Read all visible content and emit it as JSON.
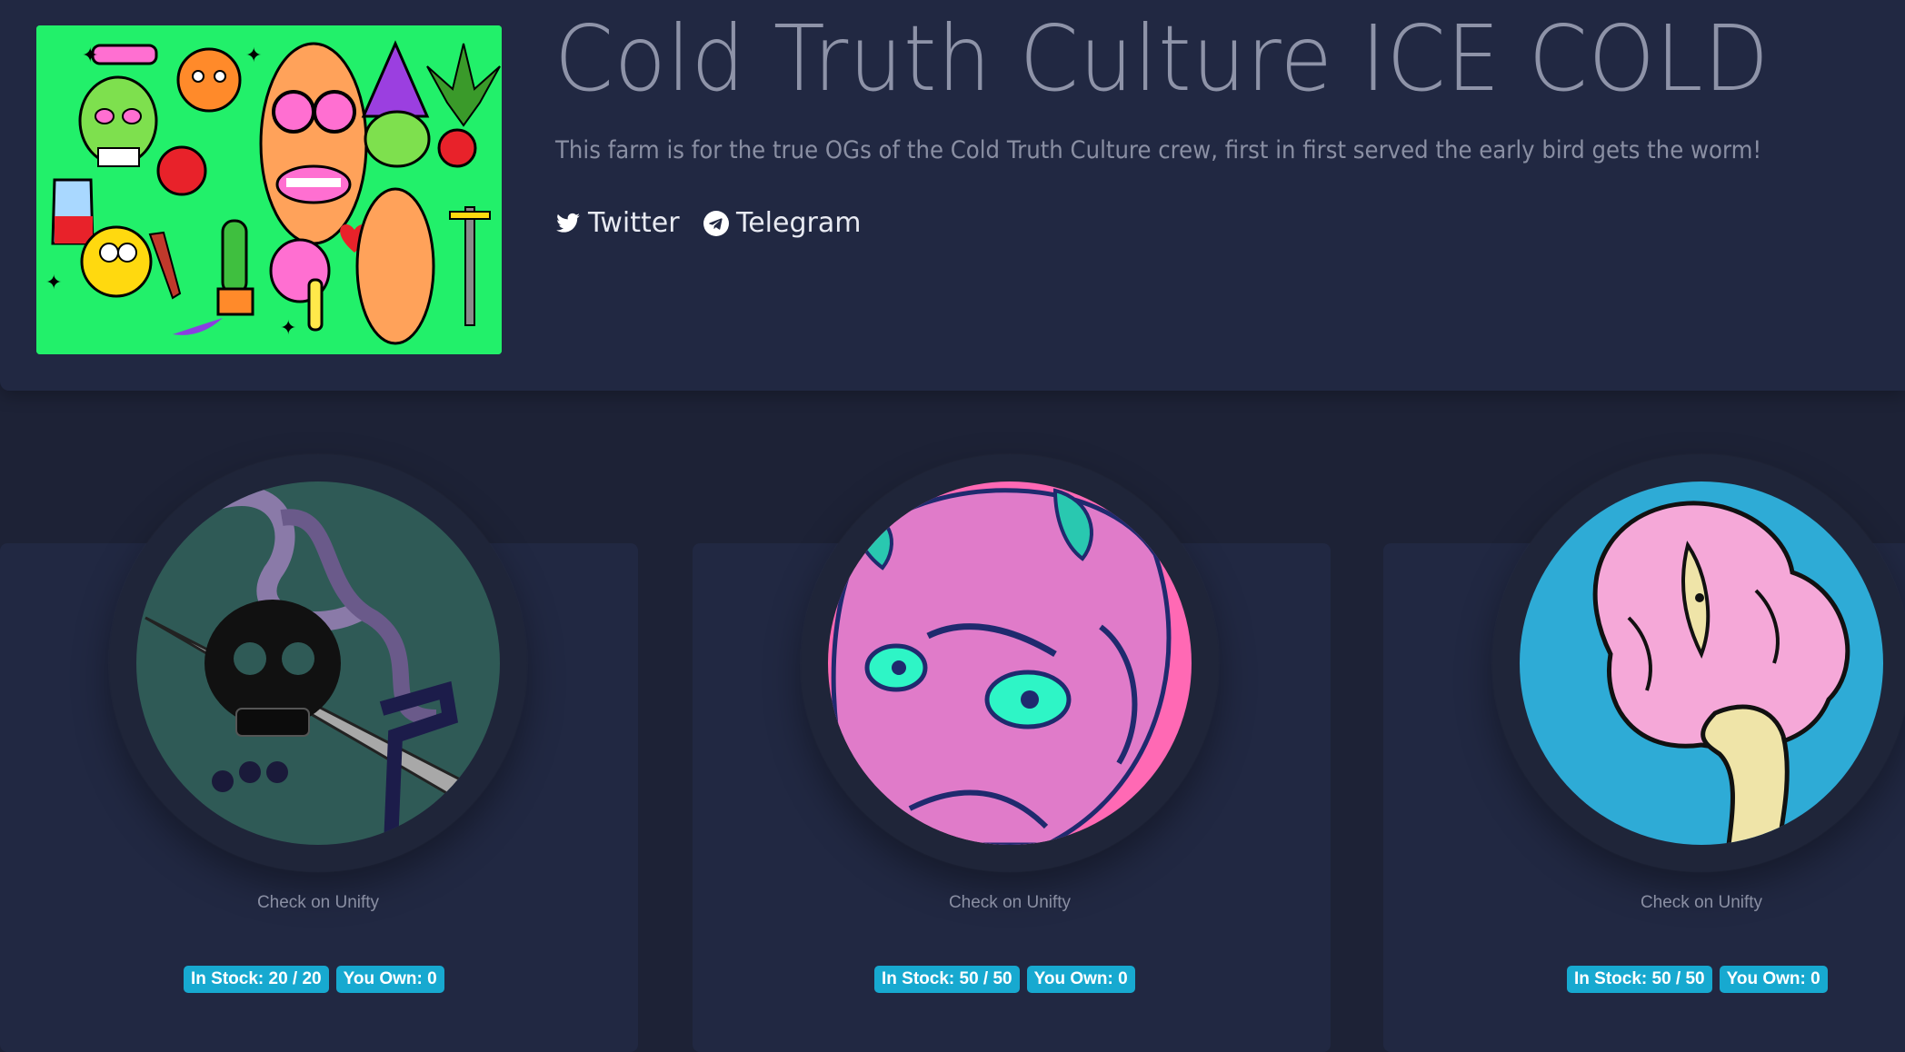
{
  "farm": {
    "title": "Cold Truth Culture ICE COLD",
    "description": "This farm is for the true OGs of the Cold Truth Culture crew, first in first served the early bird gets the worm!",
    "links": [
      {
        "label": "Twitter",
        "icon": "twitter-icon"
      },
      {
        "label": "Telegram",
        "icon": "telegram-icon"
      }
    ]
  },
  "cards": [
    {
      "link": "Check on Unifty",
      "stock": "In Stock: 20 / 20",
      "own": "You Own: 0",
      "art": "skull-snake-dagger"
    },
    {
      "link": "Check on Unifty",
      "stock": "In Stock: 50 / 50",
      "own": "You Own: 0",
      "art": "pink-oni-mask"
    },
    {
      "link": "Check on Unifty",
      "stock": "In Stock: 50 / 50",
      "own": "You Own: 0",
      "art": "pink-mushroom-eye"
    }
  ],
  "colors": {
    "background": "#1d2236",
    "panel": "#212842",
    "badge": "#17a9d0",
    "banner_green": "#22f06a"
  }
}
